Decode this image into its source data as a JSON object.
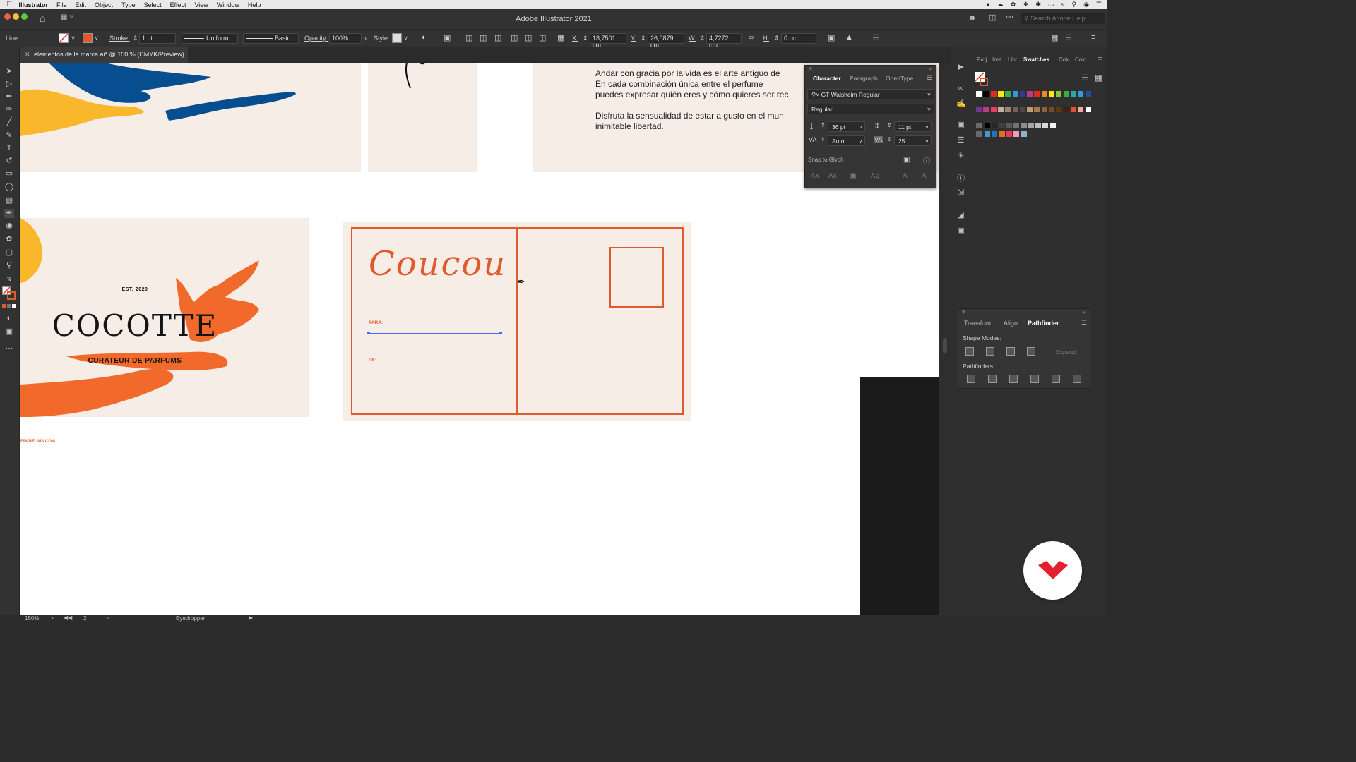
{
  "menubar": {
    "app_name": "Illustrator",
    "items": [
      "File",
      "Edit",
      "Object",
      "Type",
      "Select",
      "Effect",
      "View",
      "Window",
      "Help"
    ]
  },
  "window": {
    "title": "Adobe Illustrator 2021",
    "search_placeholder": "Search Adobe Help"
  },
  "control_bar": {
    "selection_label": "Line",
    "stroke_label": "Stroke:",
    "stroke_value": "1 pt",
    "profile": "Uniform",
    "brush": "Basic",
    "opacity_label": "Opacity:",
    "opacity_value": "100%",
    "style_label": "Style:",
    "x_label": "X:",
    "x_value": "18,7501 cm",
    "y_label": "Y:",
    "y_value": "26,0879 cm",
    "w_label": "W:",
    "w_value": "4,7272 cm",
    "h_label": "H:",
    "h_value": "0 cm"
  },
  "document_tab": {
    "title": "elementos de la marca.ai* @ 150 % (CMYK/Preview)"
  },
  "canvas": {
    "paragraph_1_lines": [
      "Andar con gracia por la vida es el arte antiguo de",
      "En  cada  combinación  única  entre  el  perfume",
      "puedes expresar quién eres y  cómo quieres ser rec"
    ],
    "paragraph_2_lines": [
      "Disfruta la sensualidad de estar a gusto en el mun",
      "inimitable libertad."
    ],
    "logo_card": {
      "est": "EST. 2020",
      "brand": "COCOTTE",
      "tagline": "CURATEUR DE PARFUMS"
    },
    "website_fragment": "EPARFUMS.COM",
    "postcard": {
      "script_title": "Coucou",
      "para_label": "PARA:",
      "de_label": "DE:"
    }
  },
  "character_panel": {
    "tabs": [
      "Character",
      "Paragraph",
      "OpenType"
    ],
    "active_tab": "Character",
    "font_family": "GT Walsheim Regular",
    "font_style": "Regular",
    "font_size": "36 pt",
    "leading": "11 pt",
    "kerning": "Auto",
    "tracking": "25",
    "snap_label": "Snap to Glyph"
  },
  "swatches_panel": {
    "tabs": [
      "Proj",
      "Ima",
      "Libr",
      "Swatches",
      "Colc",
      "Colc"
    ],
    "active_tab": "Swatches",
    "row1": [
      "#ffffff",
      "#000000",
      "#e62b1e",
      "#fbe915",
      "#3aab48",
      "#2f9cd8",
      "#303a91",
      "#c0398d",
      "#e62b1e",
      "#f08722",
      "#fbe915",
      "#8bc43f",
      "#3aab48",
      "#2aa8a2",
      "#2f9cd8",
      "#244c9d"
    ],
    "row2": [
      "#6c3a92",
      "#c0398d",
      "#e83d6b",
      "#c7b299",
      "#998675",
      "#736357",
      "#534741",
      "#c69c6d",
      "#a67c52",
      "#8c6239",
      "#754c24",
      "#603813",
      "#42210b",
      "#ec4d3a",
      "#f7a8a0",
      "#ffffff"
    ],
    "row3": [
      "#000000",
      "#262626",
      "#404040",
      "#595959",
      "#737373",
      "#8c8c8c",
      "#a6a6a6",
      "#bfbfbf",
      "#d9d9d9",
      "#f2f2f2"
    ],
    "row4": [
      "#3c9ad6",
      "#2472b9",
      "#e96d1e",
      "#e23e57",
      "#f29ab7",
      "#8fb3c6"
    ]
  },
  "pathfinder_panel": {
    "tabs": [
      "Transform",
      "Align",
      "Pathfinder"
    ],
    "active_tab": "Pathfinder",
    "shape_modes_label": "Shape Modes:",
    "expand_label": "Expand",
    "pathfinders_label": "Pathfinders:"
  },
  "status_bar": {
    "zoom": "150%",
    "artboard": "2",
    "tool": "Eyedropper"
  },
  "colors": {
    "accent_orange": "#e05a2b",
    "brand_blue": "#064e8f",
    "brand_yellow": "#f9b82b",
    "paper": "#f5ede6"
  }
}
